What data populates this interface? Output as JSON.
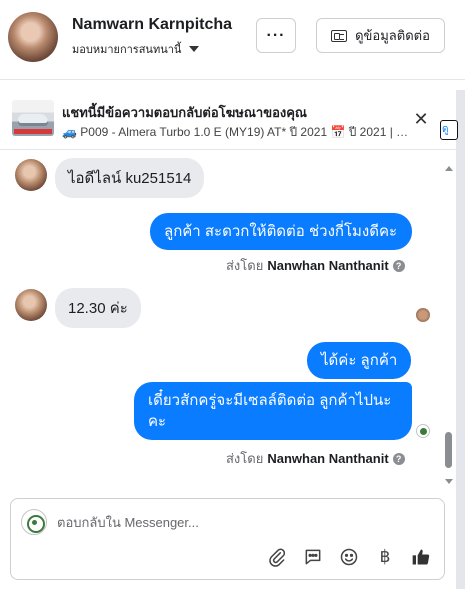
{
  "header": {
    "user_name": "Namwarn Karnpitcha",
    "assign_label": "มอบหมายการสนทนานี้",
    "more_label": "···",
    "contact_label": "ดูข้อมูลติดต่อ"
  },
  "ad": {
    "title": "แชทนี้มีข้อความตอบกลับต่อโฆษณาของคุณ",
    "subtitle": "🚙 P009 - Almera Turbo 1.0 E (MY19) AT* ปี 2021 📅 ปี 2021 | ⚙️ เ...",
    "close": "✕",
    "side_label": "ดู"
  },
  "messages": [
    {
      "from": "customer",
      "text": "ไอดีไลน์ ku251514"
    },
    {
      "from": "page",
      "text": "ลูกค้า  สะดวกให้ติดต่อ ช่วงกี่โมงดีคะ"
    },
    {
      "from": "customer",
      "text": "12.30 ค่ะ"
    },
    {
      "from": "page",
      "text": "ได้ค่ะ  ลูกค้า"
    },
    {
      "from": "page",
      "text": "เดี๋ยวสักครู่จะมีเซลล์ติดต่อ ลูกค้าไปนะคะ"
    }
  ],
  "sent_by": {
    "prefix": "ส่งโดย",
    "agent": "Nanwhan Nanthanit"
  },
  "composer": {
    "placeholder": "ตอบกลับใน Messenger...",
    "baht": "฿"
  }
}
